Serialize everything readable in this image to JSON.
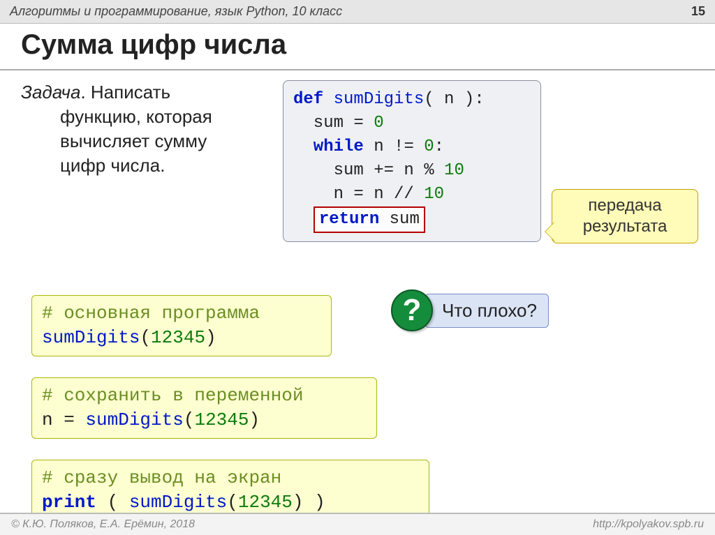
{
  "header": {
    "subject": "Алгоритмы и программирование, язык Python, 10 класс",
    "page": "15"
  },
  "title": "Сумма цифр числа",
  "task": {
    "label": "Задача",
    "dot": ". ",
    "line1_rest": "Написать",
    "line2": "функцию, которая",
    "line3": "вычисляет сумму",
    "line4": "цифр числа."
  },
  "code": {
    "l1_def": "def",
    "l1_fn": " sumDigits",
    "l1_rest": "( n ):",
    "l2_a": "  sum ",
    "l2_eq": "=",
    "l2_sp": " ",
    "l2_zero": "0",
    "l3_while": "  while",
    "l3_rest": " n != ",
    "l3_zero": "0",
    "l3_colon": ":",
    "l4_a": "    sum += n % ",
    "l4_ten": "10",
    "l5_a": "    n = n // ",
    "l5_ten": "10",
    "l6_ret": "return",
    "l6_sum": " sum",
    "l6_pad": "  "
  },
  "callout": {
    "line1": "передача",
    "line2": "результата"
  },
  "question": {
    "mark": "?",
    "text": "Что плохо?"
  },
  "snips": {
    "s1_c": "# основная программа",
    "s1_l": "sumDigits",
    "s1_p": "(",
    "s1_n": "12345",
    "s1_e": ")",
    "s2_c": "# сохранить в переменной",
    "s2_a": "n = ",
    "s2_f": "sumDigits",
    "s2_p": "(",
    "s2_n": "12345",
    "s2_e": ")",
    "s3_c": "# сразу вывод на экран",
    "s3_pr": "print",
    "s3_a": " ( ",
    "s3_f": "sumDigits",
    "s3_p": "(",
    "s3_n": "12345",
    "s3_e": ") )"
  },
  "footer": {
    "left": "© К.Ю. Поляков, Е.А. Ерёмин, 2018",
    "right": "http://kpolyakov.spb.ru"
  }
}
